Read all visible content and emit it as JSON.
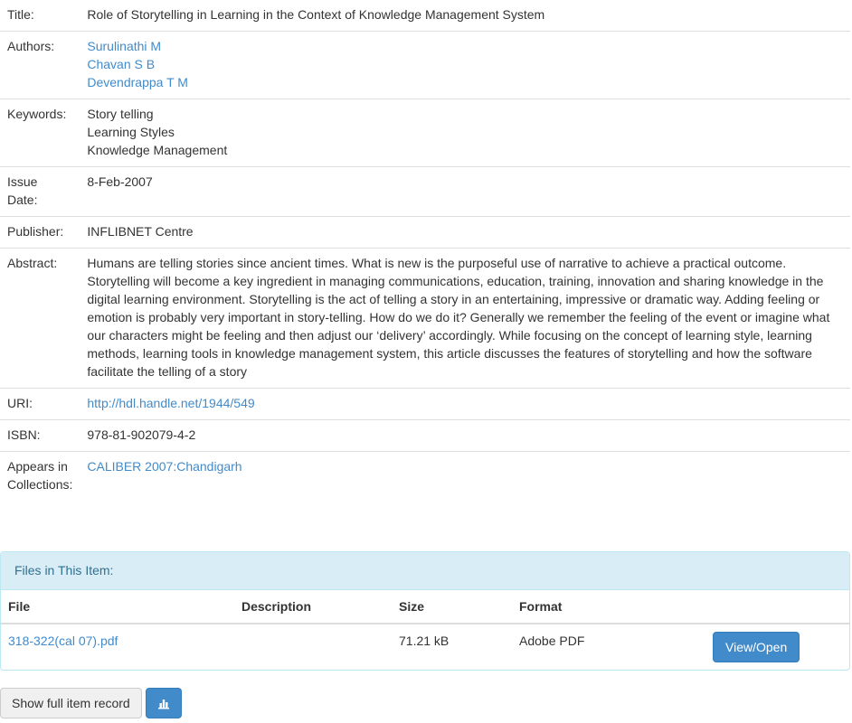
{
  "metadata": {
    "title": {
      "label": "Title:",
      "value": "Role of Storytelling in Learning in the Context of Knowledge Management System"
    },
    "authors": {
      "label": "Authors:",
      "values": [
        "Surulinathi M",
        "Chavan S B",
        "Devendrappa T M"
      ]
    },
    "keywords": {
      "label": "Keywords:",
      "values": [
        "Story telling",
        "Learning Styles",
        "Knowledge Management"
      ]
    },
    "issue_date": {
      "label_line1": "Issue",
      "label_line2": "Date:",
      "value": "8-Feb-2007"
    },
    "publisher": {
      "label": "Publisher:",
      "value": "INFLIBNET Centre"
    },
    "abstract": {
      "label": "Abstract:",
      "value": "Humans are telling stories since ancient times. What is new is the purposeful use of narrative to achieve a practical outcome. Storytelling will become a key ingredient in managing communications, education, training, innovation and sharing knowledge in the digital learning environment. Storytelling is the act of telling a story in an entertaining, impressive or dramatic way. Adding feeling or emotion is probably very important in story-telling. How do we do it? Generally we remember the feeling of the event or imagine what our characters might be feeling and then adjust our ‘delivery’ accordingly. While focusing on the concept of learning style, learning methods, learning tools in knowledge management system, this article discusses the features of storytelling and how the software facilitate the telling of a story"
    },
    "uri": {
      "label": "URI:",
      "value": "http://hdl.handle.net/1944/549"
    },
    "isbn": {
      "label": "ISBN:",
      "value": "978-81-902079-4-2"
    },
    "collections": {
      "label_line1": "Appears in",
      "label_line2": "Collections:",
      "value": "CALIBER 2007:Chandigarh"
    }
  },
  "files": {
    "heading": "Files in This Item:",
    "columns": {
      "file": "File",
      "description": "Description",
      "size": "Size",
      "format": "Format"
    },
    "rows": [
      {
        "file": "318-322(cal 07).pdf",
        "description": "",
        "size": "71.21 kB",
        "format": "Adobe PDF",
        "button": "View/Open"
      }
    ]
  },
  "actions": {
    "full_record": "Show full item record",
    "stats_icon": "bar-chart-icon"
  },
  "colors": {
    "link": "#428bca",
    "panel_heading_bg": "#d9edf7",
    "panel_heading_text": "#31708f",
    "primary_button": "#428bca"
  }
}
